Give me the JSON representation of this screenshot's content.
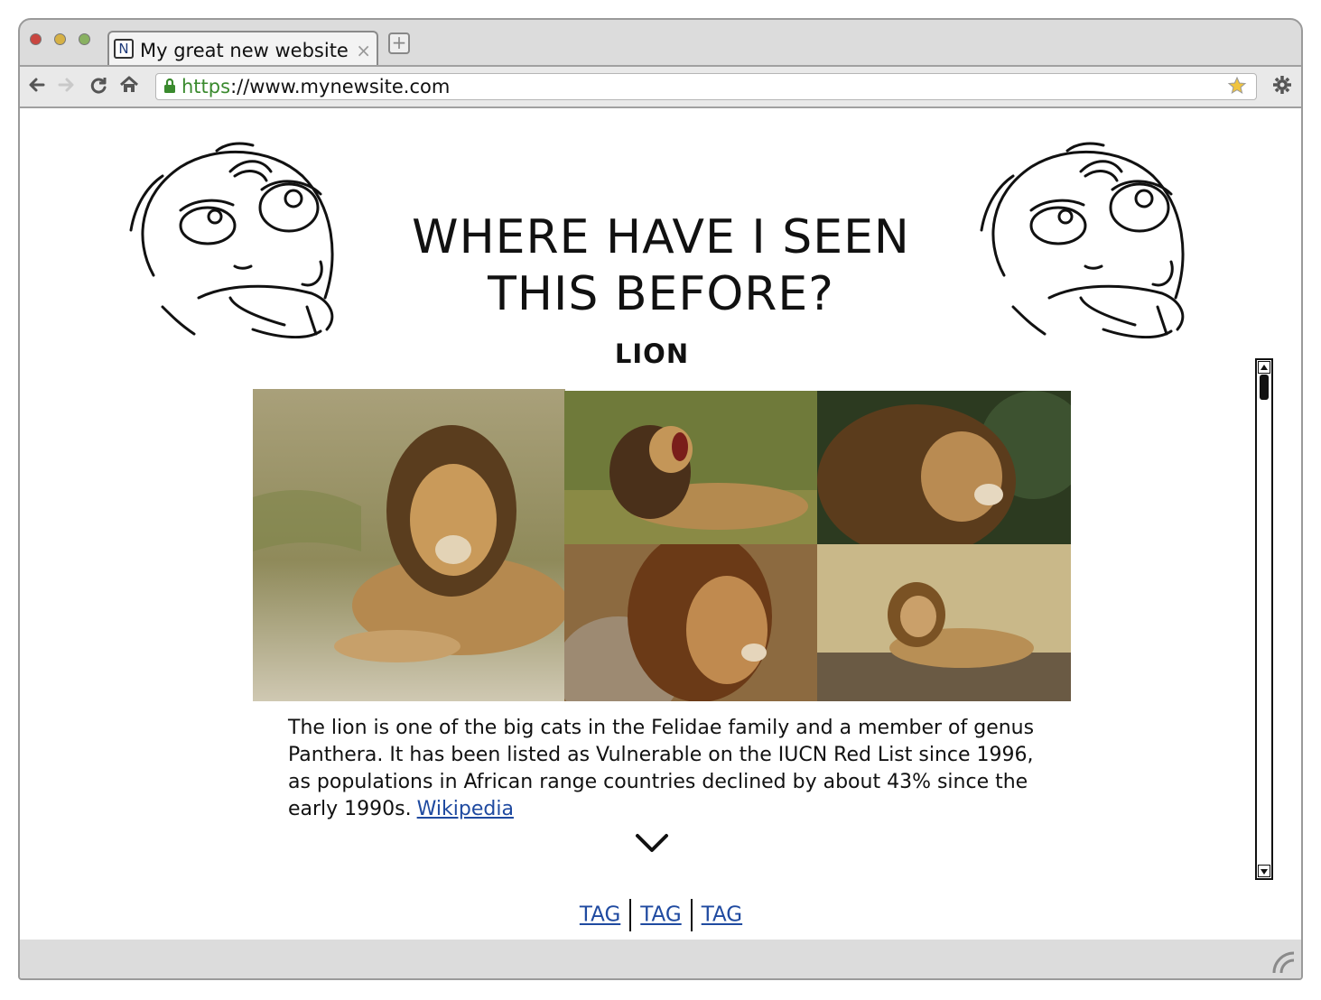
{
  "browser": {
    "tab_title": "My great new website",
    "tab_favicon": "N",
    "tab_close": "×",
    "new_tab": "+",
    "url_scheme": "https",
    "url_rest": "://www.mynewsite.com"
  },
  "icons": {
    "back": "back-arrow-icon",
    "forward": "forward-arrow-icon",
    "reload": "reload-icon",
    "home": "home-icon",
    "lock": "lock-icon",
    "bookmark": "bookmark-star-icon",
    "settings": "gear-icon",
    "thinking_face": "thinking-meme-face-icon",
    "expand": "chevron-down-icon"
  },
  "page": {
    "headline_line1": "WHERE HAVE I SEEN",
    "headline_line2": "THIS BEFORE?",
    "subheading": "LION",
    "description": "The lion is one of the big cats in the Felidae family and a member of genus Panthera. It has been listed as Vulnerable on the IUCN Red List since 1996, as populations in African range countries declined by about 43% since the early 1990s.",
    "source_link": "Wikipedia",
    "tags": [
      "TAG",
      "TAG",
      "TAG"
    ]
  },
  "colors": {
    "link": "#1f4aa0",
    "secure_scheme": "#3a8a2e",
    "chrome_gray": "#dcdcdc"
  }
}
